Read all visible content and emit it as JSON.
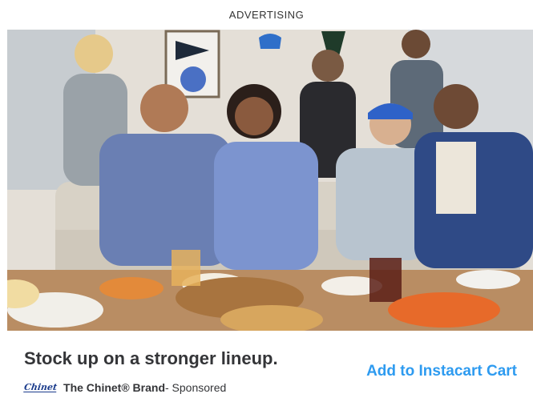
{
  "ad": {
    "label": "ADVERTISING",
    "headline": "Stock up on a stronger lineup.",
    "brand_logo_text": "Chinet",
    "brand_name": "The Chinet® Brand",
    "sponsored_text": " - Sponsored",
    "cta_label": "Add to Instacart Cart"
  },
  "colors": {
    "cta": "#2e9bf0",
    "headline": "#343538",
    "brand_logo": "#1b3c8c"
  }
}
